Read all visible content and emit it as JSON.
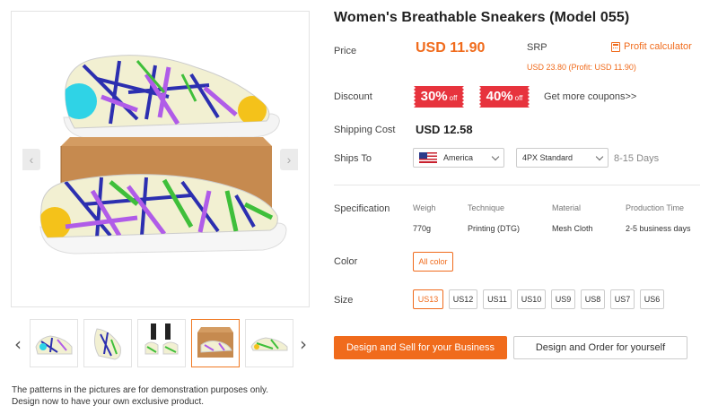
{
  "product": {
    "title": "Women's Breathable Sneakers (Model 055)"
  },
  "gallery": {
    "disclaimer_line1": "The patterns in the pictures are for demonstration purposes only.",
    "disclaimer_line2": "Design now to have your own exclusive product.",
    "thumbnail_count": 5,
    "active_thumbnail": 4
  },
  "price": {
    "label": "Price",
    "value": "USD 11.90",
    "srp_label": "SRP",
    "srp_value": "USD 23.80 (Profit: USD 11.90)",
    "profit_calculator": "Profit calculator"
  },
  "discount": {
    "label": "Discount",
    "coupons": [
      {
        "pct": "30%",
        "off": "off"
      },
      {
        "pct": "40%",
        "off": "off"
      }
    ],
    "more_link": "Get more coupons>>"
  },
  "shipping": {
    "cost_label": "Shipping Cost",
    "cost_value": "USD 12.58",
    "ships_to_label": "Ships To",
    "country": "America",
    "method": "4PX Standard",
    "days": "8-15 Days"
  },
  "specification": {
    "label": "Specification",
    "columns": [
      {
        "head": "Weigh",
        "value": "770g"
      },
      {
        "head": "Technique",
        "value": "Printing (DTG)"
      },
      {
        "head": "Material",
        "value": "Mesh Cloth"
      },
      {
        "head": "Production Time",
        "value": "2-5 business days"
      }
    ]
  },
  "color": {
    "label": "Color",
    "selected": "All color"
  },
  "size": {
    "label": "Size",
    "options": [
      "US13",
      "US12",
      "US11",
      "US10",
      "US9",
      "US8",
      "US7",
      "US6"
    ],
    "selected": "US13"
  },
  "actions": {
    "primary": "Design and Sell for your Business",
    "secondary": "Design and Order for yourself"
  },
  "colors": {
    "accent": "#f06b1c",
    "coupon_red": "#e7333d"
  }
}
